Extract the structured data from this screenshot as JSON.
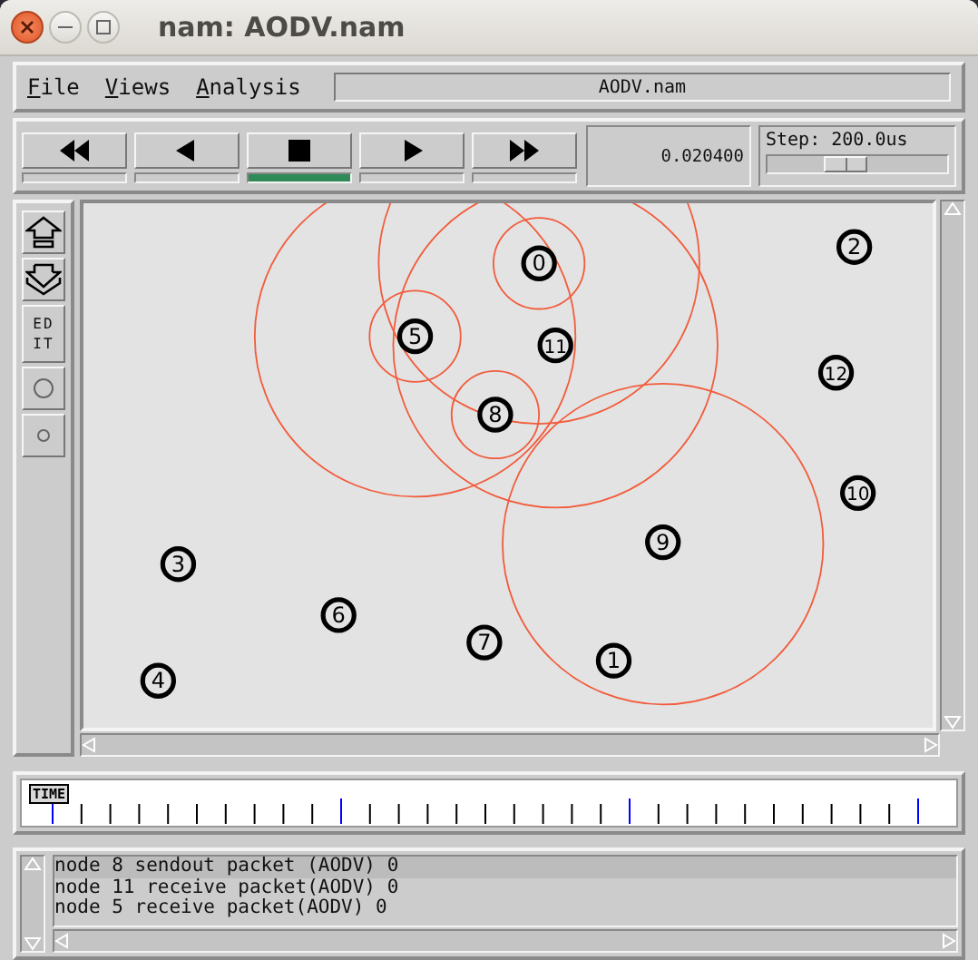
{
  "window": {
    "title": "nam: AODV.nam"
  },
  "menu": [
    {
      "label": "File"
    },
    {
      "label": "Views"
    },
    {
      "label": "Analysis"
    }
  ],
  "file_field": {
    "value": "AODV.nam"
  },
  "transport": [
    {
      "kind": "rewind",
      "selected": false
    },
    {
      "kind": "back",
      "selected": false
    },
    {
      "kind": "stop",
      "selected": true
    },
    {
      "kind": "play",
      "selected": false
    },
    {
      "kind": "forward",
      "selected": false
    }
  ],
  "time_display": "0.020400",
  "step": {
    "label": "Step: 200.0us",
    "level": 0.43
  },
  "edit_tools": [
    {
      "kind": "zoom_in"
    },
    {
      "kind": "zoom_out"
    },
    {
      "kind": "edit",
      "label": "ED IT"
    },
    {
      "kind": "big_circle"
    },
    {
      "kind": "small_circle"
    }
  ],
  "nodes": [
    {
      "label": "0"
    },
    {
      "label": "2"
    },
    {
      "label": "5"
    },
    {
      "label": "11"
    },
    {
      "label": "12"
    },
    {
      "label": "8"
    },
    {
      "label": "10"
    },
    {
      "label": "9"
    },
    {
      "label": "3"
    },
    {
      "label": "6"
    },
    {
      "label": "7"
    },
    {
      "label": "1"
    },
    {
      "label": "4"
    }
  ],
  "timeline": {
    "label": "TIME"
  },
  "log": [
    {
      "text": "node 8 sendout packet (AODV) 0",
      "selected": true
    },
    {
      "text": "node 11 receive packet(AODV) 0",
      "selected": false
    },
    {
      "text": "node 5 receive packet(AODV) 0",
      "selected": false
    }
  ]
}
